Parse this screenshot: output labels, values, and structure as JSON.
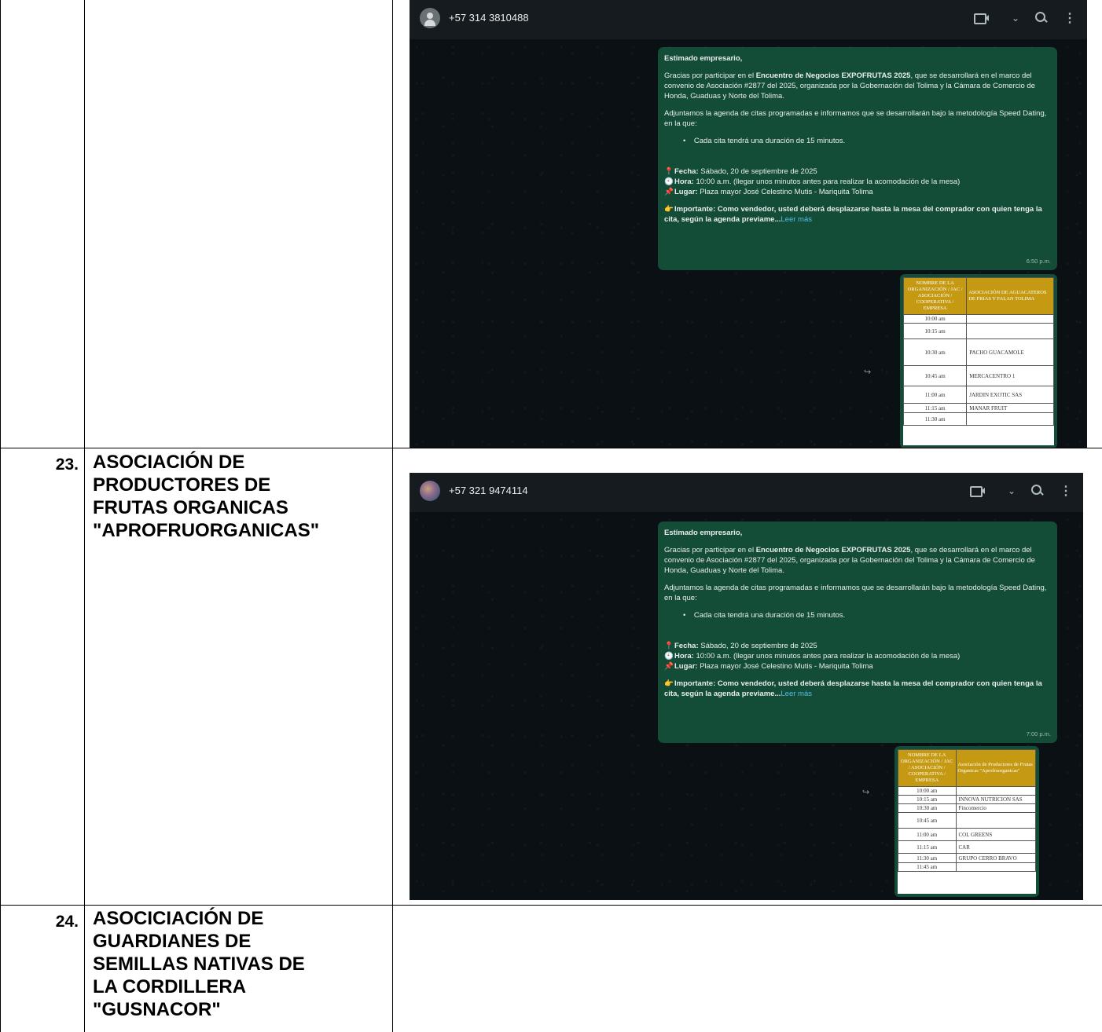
{
  "rows": [
    {
      "number": "",
      "org_lines": [],
      "chat": {
        "phone": "+57 314 3810488",
        "avatar": "default-user",
        "greeting": "Estimado empresario,",
        "p1_a": "Gracias por participar en el ",
        "p1_b": "Encuentro de Negocios EXPOFRUTAS 2025",
        "p1_c": ", que se desarrollará en el marco del convenio de Asociación #2877 del 2025, organizada por la Gobernación del Tolima y la Cámara de Comercio de Honda, Guaduas y Norte del Tolima.",
        "p2": "Adjuntamos la agenda de citas programadas e informamos que se desarrollarán bajo la metodología Speed Dating, en la que:",
        "bullet": "Cada cita tendrá una duración de 15 minutos.",
        "fecha_label": "Fecha:",
        "fecha_value": " Sábado, 20 de septiembre de 2025",
        "hora_label": "Hora:",
        "hora_value": " 10:00 a.m. (llegar unos minutos antes para realizar la acomodación de la mesa)",
        "lugar_label": "Lugar:",
        "lugar_value": " Plaza mayor José Celestino Mutis - Mariquita Tolima",
        "importante": "Importante: Como vendedor, usted deberá desplazarse hasta la mesa del comprador con quien tenga la cita, según la agenda previame...",
        "leer_mas": "Leer más",
        "time": "6:50 p.m.",
        "agenda": {
          "header_left": "NOMBRE DE LA ORGANIZACIÓN / JAC / ASOCIACIÓN / COOPERATIVA / EMPRESA",
          "header_right": "ASOCIACIÓN DE AGUACATEROS DE FRIAS Y FALAN TOLIMA",
          "rows": [
            [
              "10:00 am",
              ""
            ],
            [
              "10:15 am",
              ""
            ],
            [
              "10:30 am",
              "PACHO GUACAMOLE"
            ],
            [
              "10:45 am",
              "MERCACENTRO 1"
            ],
            [
              "11:00 am",
              "JARDIN EXOTIC SAS"
            ],
            [
              "11:15 am",
              "MANAR FRUIT"
            ],
            [
              "11:30 am",
              ""
            ]
          ]
        }
      }
    },
    {
      "number": "23.",
      "org_lines": [
        "ASOCIACIÓN DE",
        "PRODUCTORES DE",
        "FRUTAS ORGANICAS",
        "\"APROFRUORGANICAS\""
      ],
      "chat": {
        "phone": "+57 321 9474114",
        "avatar": "photo",
        "greeting": "Estimado empresario,",
        "p1_a": "Gracias por participar en el ",
        "p1_b": "Encuentro de Negocios EXPOFRUTAS 2025",
        "p1_c": ", que se desarrollará en el marco del convenio de Asociación #2877 del 2025, organizada por la Gobernación del Tolima y la Cámara de Comercio de Honda, Guaduas y Norte del Tolima.",
        "p2": "Adjuntamos la agenda de citas programadas e informamos que se desarrollarán bajo la metodología Speed Dating, en la que:",
        "bullet": "Cada cita tendrá una duración de 15 minutos.",
        "fecha_label": "Fecha:",
        "fecha_value": " Sábado, 20 de septiembre de 2025",
        "hora_label": "Hora:",
        "hora_value": " 10:00 a.m. (llegar unos minutos antes para realizar la acomodación de la mesa)",
        "lugar_label": "Lugar:",
        "lugar_value": " Plaza mayor José Celestino Mutis - Mariquita Tolima",
        "importante": "Importante: Como vendedor, usted deberá desplazarse hasta la mesa del comprador con quien tenga la cita, según la agenda previame...",
        "leer_mas": "Leer más",
        "time": "7:00 p.m.",
        "agenda": {
          "header_left": "NOMBRE DE LA ORGANIZACIÓN / JAC / ASOCIACIÓN / COOPERATIVA / EMPRESA",
          "header_right": "Asociación de Productores de Frutas Organicas \"Aprofruorganicas\"",
          "rows": [
            [
              "10:00 am",
              ""
            ],
            [
              "10:15 am",
              "INNOVA NUTRICION SAS"
            ],
            [
              "10:30 am",
              "Fincomercio"
            ],
            [
              "10:45 am",
              ""
            ],
            [
              "11:00 am",
              "COL GREENS"
            ],
            [
              "11:15 am",
              "CAR"
            ],
            [
              "11:30 am",
              "GRUPO CERRO BRAVO"
            ],
            [
              "11:45 am",
              ""
            ]
          ]
        }
      }
    },
    {
      "number": "24.",
      "org_lines": [
        "ASOCICIACIÓN DE",
        "GUARDIANES DE",
        "SEMILLAS NATIVAS DE",
        "LA CORDILLERA",
        "\"GUSNACOR\""
      ]
    }
  ]
}
